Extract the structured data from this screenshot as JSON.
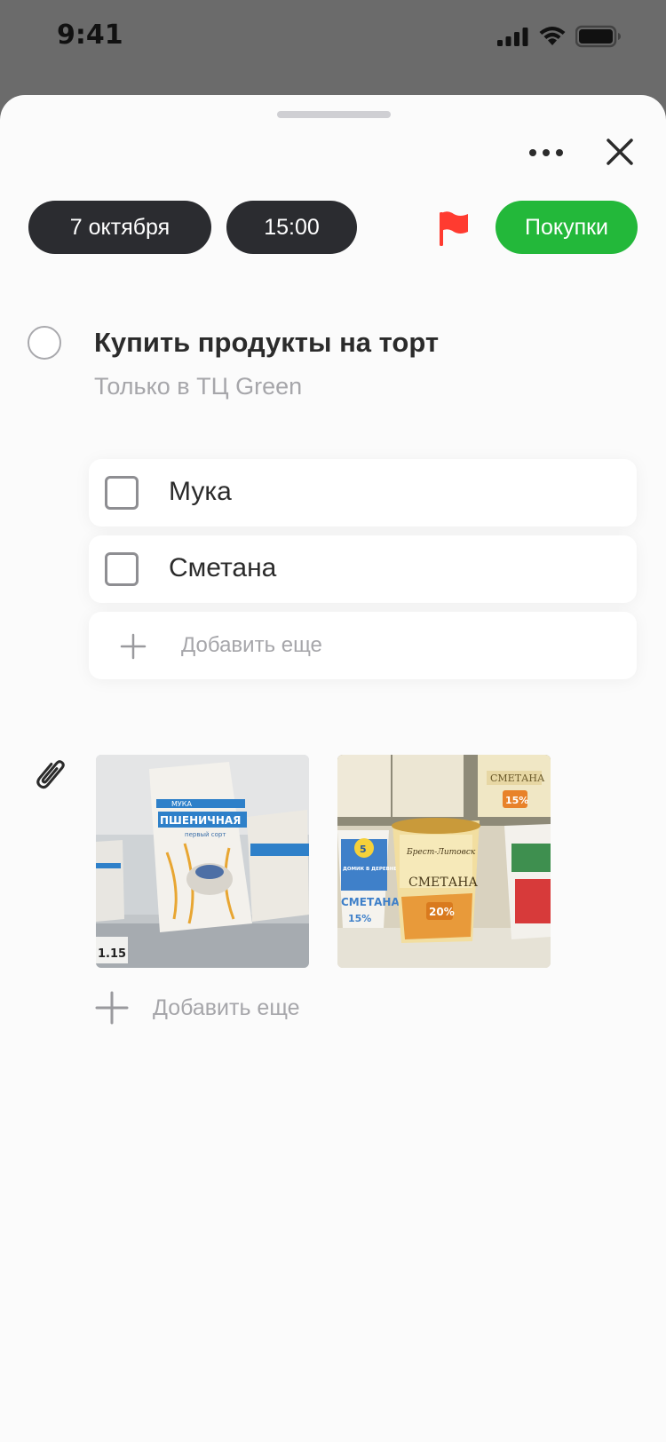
{
  "status_bar": {
    "time": "9:41"
  },
  "header": {
    "more_icon": "more-icon",
    "close_icon": "close-icon"
  },
  "chips": {
    "date": "7 октября",
    "time": "15:00",
    "tag": "Покупки"
  },
  "flag": {
    "icon": "flag-icon",
    "color": "#ff3b30"
  },
  "colors": {
    "accent": "#23b83a",
    "chip_dark": "#2b2c30",
    "flag": "#ff3b30"
  },
  "task": {
    "title": "Купить продукты на торт",
    "note": "Только в ТЦ Green",
    "completed": false
  },
  "subtasks": [
    {
      "label": "Мука",
      "checked": false
    },
    {
      "label": "Сметана",
      "checked": false
    }
  ],
  "add_subtask_label": "Добавить еще",
  "attachments": {
    "icon": "paperclip-icon",
    "items": [
      {
        "label": "photo-flour",
        "text": [
          "МУКА",
          "ПШЕНИЧНАЯ",
          "первый сорт",
          "1.15"
        ]
      },
      {
        "label": "photo-sour-cream",
        "text": [
          "Брест-Литовск",
          "СМЕТАНА",
          "20%",
          "СМЕТАНА",
          "15%",
          "СМЕТАНА",
          "15%",
          "5",
          "ДОМИК В ДЕРЕВНЕ"
        ]
      }
    ],
    "add_label": "Добавить еще"
  }
}
